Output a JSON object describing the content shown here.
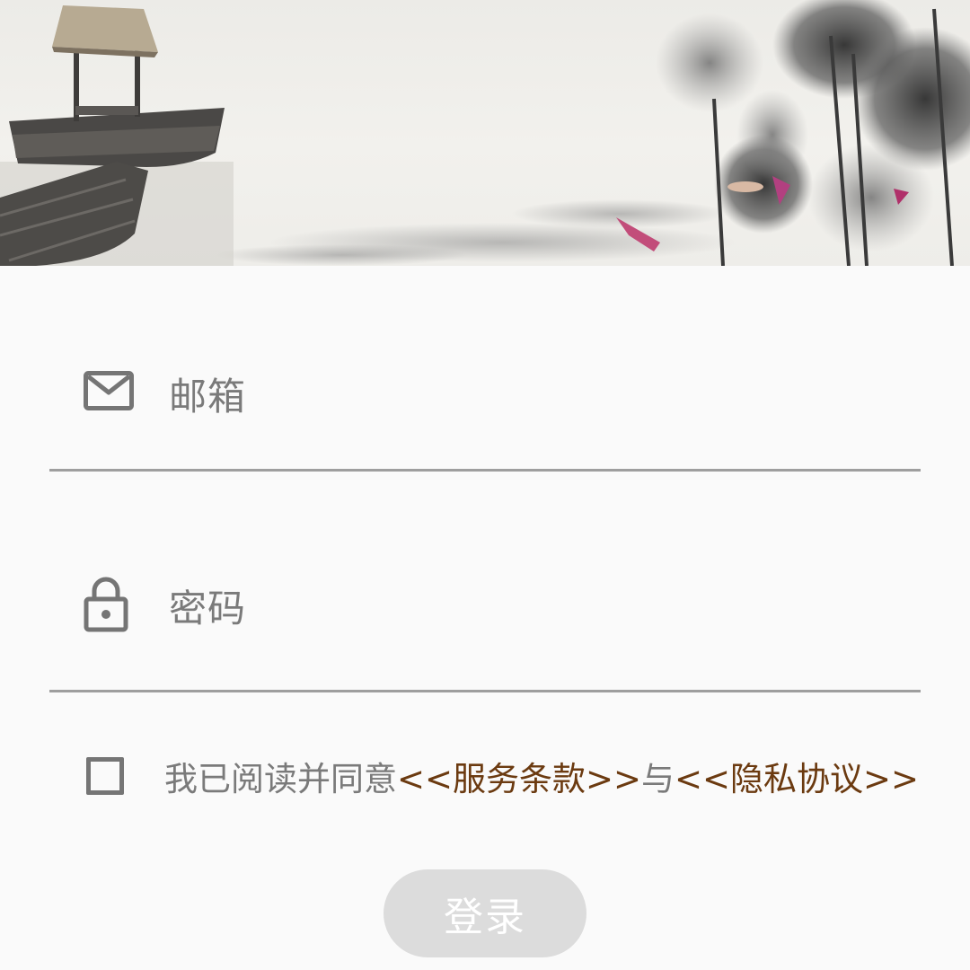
{
  "email": {
    "placeholder": "邮箱",
    "icon": "mail-icon"
  },
  "password": {
    "placeholder": "密码",
    "icon": "lock-icon"
  },
  "agreement": {
    "checked": false,
    "prefix": "我已阅读并同意",
    "terms_link": "<<服务条款>>",
    "conjunction": "与",
    "privacy_link": "<<隐私协议>>"
  },
  "login_button": {
    "label": "登录",
    "enabled": false
  },
  "colors": {
    "link": "#6b3a10",
    "placeholder": "#7a7a7a",
    "divider": "#9e9e9e",
    "button_disabled": "#dcdcdc"
  }
}
